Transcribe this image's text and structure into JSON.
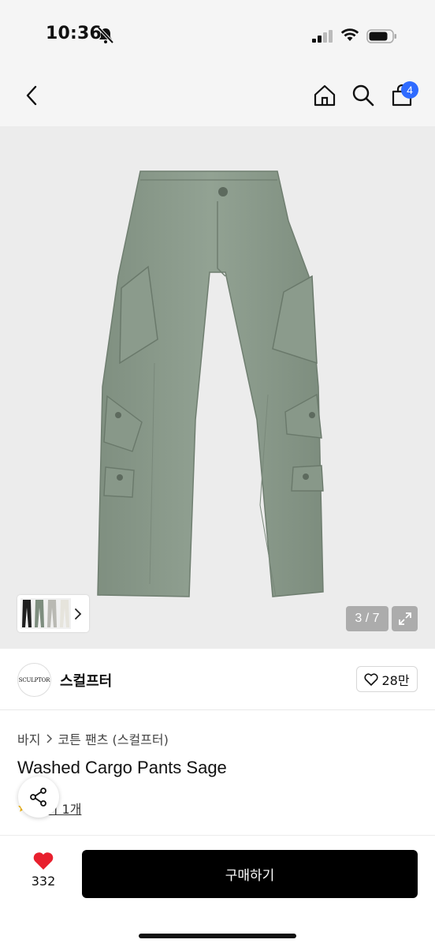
{
  "status_bar": {
    "time": "10:36"
  },
  "nav": {
    "cart_count": "4"
  },
  "gallery": {
    "counter": "3 / 7"
  },
  "brand": {
    "logo_text": "SCULPTOR",
    "name": "스컬프터",
    "likes": "28만"
  },
  "breadcrumb": {
    "category": "바지",
    "subcategory": "코튼 팬츠 (스컬프터)"
  },
  "product": {
    "title": "Washed Cargo Pants Sage",
    "reviews": "후기 1개"
  },
  "bottom": {
    "fav_count": "332",
    "buy_label": "구매하기"
  },
  "colors": {
    "accent_badge": "#2f6bff",
    "heart": "#e8202e",
    "pants": "#8a9a8b",
    "buy_button": "#000000"
  }
}
